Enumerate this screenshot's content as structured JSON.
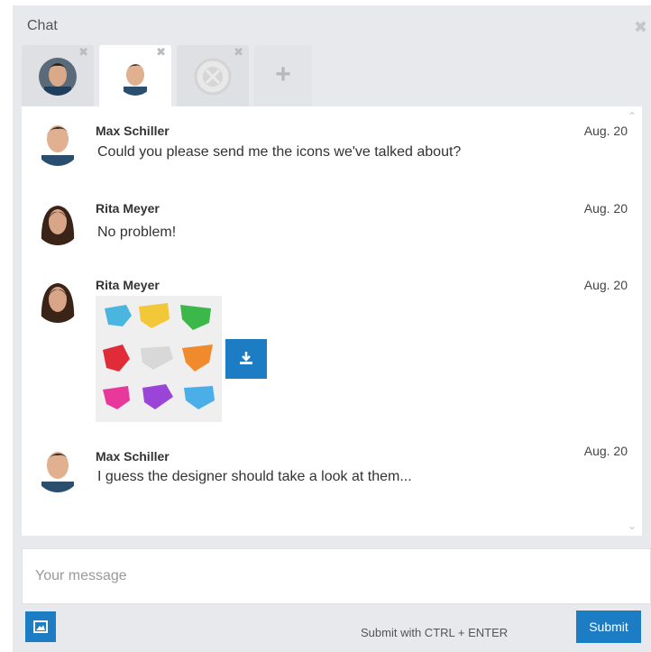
{
  "window": {
    "title": "Chat",
    "close_icon": "close-icon"
  },
  "tabs": [
    {
      "avatar_icon": "avatar-male-1",
      "close_icon": "close-icon"
    },
    {
      "avatar_icon": "avatar-male-2",
      "close_icon": "close-icon",
      "active": true
    },
    {
      "avatar_icon": "avatar-placeholder",
      "close_icon": "close-icon"
    },
    {
      "add_icon": "plus-icon",
      "label": "+"
    }
  ],
  "messages": [
    {
      "author": "Max Schiller",
      "date": "Aug. 20",
      "text": "Could you please send me the icons we've talked about?"
    },
    {
      "author": "Rita Meyer",
      "date": "Aug. 20",
      "text": "No problem!"
    },
    {
      "author": "Rita Meyer",
      "date": "Aug. 20",
      "attachment": "image-thumbnail",
      "download_icon": "download-icon"
    },
    {
      "author": "Max Schiller",
      "date": "Aug. 20",
      "text": "I guess the designer should take a look at them..."
    }
  ],
  "composer": {
    "placeholder": "Your message",
    "value": "",
    "image_button_icon": "image-icon",
    "hint": "Submit with CTRL + ENTER",
    "submit_label": "Submit"
  },
  "colors": {
    "accent": "#1c7cc4",
    "panel": "#e8e9ec"
  }
}
